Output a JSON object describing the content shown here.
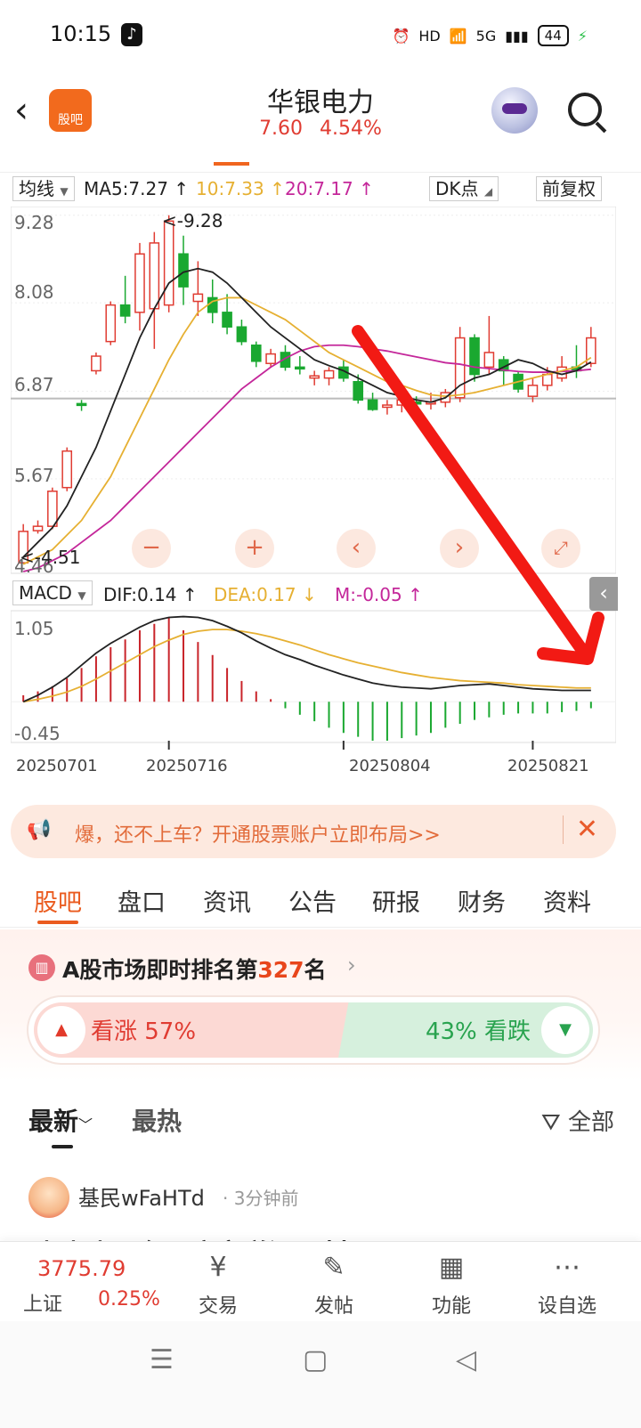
{
  "status_bar": {
    "time": "10:15",
    "battery": "44",
    "net": "5G"
  },
  "header": {
    "back_icon": "back-chevron-icon",
    "app_badge": "股吧",
    "stock_name": "华银电力",
    "price": "7.60",
    "change_pct": "4.54%"
  },
  "indicators": {
    "ma_select": "均线",
    "ma5": "MA5:7.27",
    "ma10": "10:7.33",
    "ma20": "20:7.17",
    "dk_select": "DK点",
    "adjust": "前复权",
    "macd_select": "MACD",
    "dif": "DIF:0.14",
    "dea": "DEA:0.17",
    "m": "M:-0.05",
    "arrow_up": "↑",
    "arrow_down": "↓",
    "colors": {
      "up": "#e03c32",
      "down": "#1aa830",
      "ma5": "#222222",
      "ma10": "#e6b032",
      "ma20": "#c4279a"
    }
  },
  "chart_data": [
    {
      "type": "candlestick",
      "y_ticks": [
        "9.28",
        "8.08",
        "6.87",
        "5.67",
        "4.46"
      ],
      "annotations": {
        "high": "<-9.28",
        "low": "<-4.51"
      },
      "ohlc": [
        [
          4.52,
          5.05,
          4.51,
          4.95
        ],
        [
          4.96,
          5.1,
          4.92,
          5.02
        ],
        [
          5.02,
          5.55,
          4.98,
          5.5
        ],
        [
          5.55,
          6.1,
          5.5,
          6.05
        ],
        [
          6.7,
          6.75,
          6.6,
          6.68
        ],
        [
          7.15,
          7.4,
          7.1,
          7.35
        ],
        [
          7.55,
          8.1,
          7.5,
          8.05
        ],
        [
          8.05,
          8.45,
          7.8,
          7.9
        ],
        [
          7.95,
          8.9,
          7.7,
          8.75
        ],
        [
          8.0,
          9.05,
          7.45,
          8.9
        ],
        [
          8.05,
          9.28,
          7.95,
          9.2
        ],
        [
          8.75,
          9.0,
          8.05,
          8.3
        ],
        [
          8.1,
          8.65,
          7.9,
          8.2
        ],
        [
          8.15,
          8.4,
          7.8,
          7.95
        ],
        [
          7.95,
          8.2,
          7.65,
          7.75
        ],
        [
          7.75,
          7.85,
          7.5,
          7.55
        ],
        [
          7.5,
          7.55,
          7.2,
          7.28
        ],
        [
          7.25,
          7.45,
          7.2,
          7.38
        ],
        [
          7.4,
          7.5,
          7.15,
          7.2
        ],
        [
          7.2,
          7.35,
          7.1,
          7.18
        ],
        [
          7.05,
          7.15,
          6.95,
          7.08
        ],
        [
          7.05,
          7.2,
          6.95,
          7.15
        ],
        [
          7.2,
          7.3,
          7.0,
          7.05
        ],
        [
          7.0,
          7.1,
          6.7,
          6.75
        ],
        [
          6.75,
          6.85,
          6.6,
          6.62
        ],
        [
          6.65,
          6.75,
          6.55,
          6.68
        ],
        [
          6.68,
          6.9,
          6.58,
          6.75
        ],
        [
          6.72,
          6.8,
          6.6,
          6.7
        ],
        [
          6.7,
          6.85,
          6.62,
          6.72
        ],
        [
          6.72,
          6.9,
          6.65,
          6.85
        ],
        [
          6.78,
          7.75,
          6.72,
          7.6
        ],
        [
          7.6,
          7.65,
          7.0,
          7.1
        ],
        [
          7.2,
          7.9,
          7.1,
          7.4
        ],
        [
          7.3,
          7.35,
          6.95,
          7.15
        ],
        [
          7.1,
          7.15,
          6.85,
          6.9
        ],
        [
          6.8,
          7.05,
          6.72,
          6.95
        ],
        [
          6.95,
          7.2,
          6.88,
          7.1
        ],
        [
          7.05,
          7.35,
          7.0,
          7.2
        ],
        [
          7.2,
          7.5,
          7.05,
          7.15
        ],
        [
          7.25,
          7.75,
          7.2,
          7.6
        ]
      ],
      "ma5": [
        4.6,
        4.8,
        5.0,
        5.3,
        5.7,
        6.1,
        6.6,
        7.1,
        7.6,
        8.0,
        8.35,
        8.5,
        8.55,
        8.5,
        8.35,
        8.15,
        7.95,
        7.75,
        7.6,
        7.45,
        7.3,
        7.22,
        7.15,
        7.05,
        6.95,
        6.85,
        6.8,
        6.75,
        6.72,
        6.78,
        6.95,
        7.05,
        7.1,
        7.2,
        7.3,
        7.25,
        7.15,
        7.1,
        7.15,
        7.27
      ],
      "ma10": [
        4.5,
        4.6,
        4.7,
        4.9,
        5.1,
        5.4,
        5.7,
        6.1,
        6.5,
        6.9,
        7.3,
        7.65,
        7.95,
        8.1,
        8.15,
        8.15,
        8.05,
        7.95,
        7.85,
        7.7,
        7.55,
        7.4,
        7.3,
        7.2,
        7.1,
        7.0,
        6.95,
        6.88,
        6.82,
        6.8,
        6.82,
        6.85,
        6.9,
        6.95,
        7.0,
        7.05,
        7.1,
        7.15,
        7.2,
        7.33
      ],
      "ma20": [
        4.4,
        4.45,
        4.55,
        4.65,
        4.8,
        4.95,
        5.1,
        5.3,
        5.5,
        5.7,
        5.9,
        6.1,
        6.3,
        6.5,
        6.7,
        6.9,
        7.05,
        7.2,
        7.32,
        7.42,
        7.48,
        7.5,
        7.5,
        7.48,
        7.45,
        7.42,
        7.38,
        7.34,
        7.3,
        7.26,
        7.24,
        7.2,
        7.18,
        7.16,
        7.14,
        7.13,
        7.13,
        7.14,
        7.15,
        7.17
      ]
    },
    {
      "type": "bar",
      "title": "MACD",
      "y_ticks": [
        "1.05",
        "-0.45"
      ],
      "x": [
        "20250701",
        "20250716",
        "20250804",
        "20250821"
      ],
      "m": [
        0.05,
        0.08,
        0.12,
        0.18,
        0.26,
        0.35,
        0.42,
        0.48,
        0.55,
        0.6,
        0.65,
        0.55,
        0.46,
        0.36,
        0.26,
        0.16,
        0.08,
        0.02,
        -0.05,
        -0.1,
        -0.15,
        -0.2,
        -0.24,
        -0.27,
        -0.3,
        -0.3,
        -0.28,
        -0.26,
        -0.24,
        -0.2,
        -0.17,
        -0.14,
        -0.12,
        -0.1,
        -0.09,
        -0.09,
        -0.09,
        -0.08,
        -0.07,
        -0.05
      ],
      "dif": [
        0.0,
        0.08,
        0.18,
        0.3,
        0.45,
        0.6,
        0.72,
        0.82,
        0.92,
        1.0,
        1.04,
        1.05,
        1.04,
        1.0,
        0.93,
        0.85,
        0.75,
        0.66,
        0.58,
        0.52,
        0.45,
        0.39,
        0.33,
        0.28,
        0.23,
        0.2,
        0.18,
        0.17,
        0.16,
        0.18,
        0.2,
        0.21,
        0.22,
        0.2,
        0.18,
        0.16,
        0.15,
        0.14,
        0.14,
        0.14
      ],
      "dea": [
        0.0,
        0.03,
        0.07,
        0.12,
        0.19,
        0.28,
        0.38,
        0.48,
        0.58,
        0.68,
        0.76,
        0.83,
        0.87,
        0.89,
        0.89,
        0.87,
        0.84,
        0.8,
        0.75,
        0.7,
        0.64,
        0.58,
        0.53,
        0.48,
        0.44,
        0.4,
        0.36,
        0.33,
        0.3,
        0.28,
        0.26,
        0.25,
        0.24,
        0.23,
        0.21,
        0.2,
        0.19,
        0.18,
        0.17,
        0.17
      ]
    }
  ],
  "chart_controls": {
    "zoom_out": "−",
    "zoom_in": "+",
    "prev": "‹",
    "next": "›",
    "expand_icon": "expand-icon"
  },
  "ad": {
    "text": "爆，还不上车？开通股票账户立即布局>>",
    "close": "✕"
  },
  "content_tabs": [
    "股吧",
    "盘口",
    "资讯",
    "公告",
    "研报",
    "财务",
    "资料"
  ],
  "ranking": {
    "prefix": "A股市场即时排名第",
    "rank": "327",
    "suffix": "名",
    "bull_label": "看涨 57%",
    "bear_label": "43% 看跌",
    "bull_fraction": 0.57
  },
  "feed": {
    "latest": "最新",
    "hot": "最热",
    "filter": "全部"
  },
  "post": {
    "user": "基民wFaHTd",
    "time": "· 3分钟前",
    "content": "跌跌跌，今天这赛道没题材"
  },
  "bottom_nav": {
    "index_value": "3775.79",
    "index_name": "上证",
    "index_change": "0.25%",
    "items": [
      {
        "label": "交易",
        "icon": "yuan-circle-icon"
      },
      {
        "label": "发帖",
        "icon": "edit-icon"
      },
      {
        "label": "功能",
        "icon": "grid-icon"
      },
      {
        "label": "设自选",
        "icon": "more-icon"
      }
    ]
  }
}
